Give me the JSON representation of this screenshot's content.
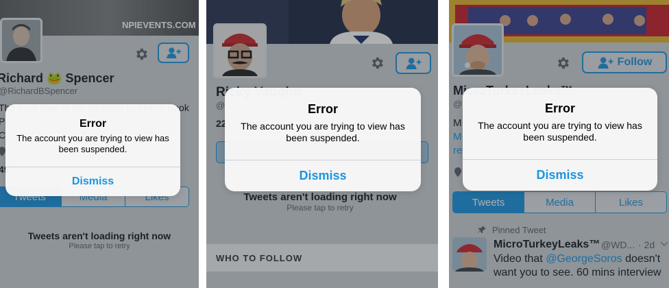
{
  "panels": [
    {
      "banner_text": "NPIEVENTS.COM",
      "name": "Richard",
      "name_suffix": "Spencer",
      "name_emoji": "🐸",
      "handle": "@RichardBSpencer",
      "bio_fragments": [
        "The Kool Man of the Alt-Right to Chess Book",
        "Pr",
        "Co"
      ],
      "stat_fragment": "49",
      "tabs": [
        "Tweets",
        "Media",
        "Likes"
      ],
      "empty_title": "Tweets aren't loading right now",
      "empty_subtitle": "Please tap to retry",
      "alert": {
        "title": "Error",
        "message": "The account you are trying to view has been suspended.",
        "button": "Dismiss"
      }
    },
    {
      "name_fragment": "Ricky Vaughn",
      "handle_fragment": "@",
      "stat_fragment": "22",
      "empty_title": "Tweets aren't loading right now",
      "empty_subtitle": "Please tap to retry",
      "section_header": "WHO TO FOLLOW",
      "alert": {
        "title": "Error",
        "message": "The account you are trying to view has been suspended.",
        "button": "Dismiss"
      }
    },
    {
      "follow_label": "Follow",
      "name_fragment": "MicroTurkeyLeaks™",
      "handle_fragment": "@",
      "bio_fragments": [
        "M",
        "M",
        "re"
      ],
      "tabs": [
        "Tweets",
        "Media",
        "Likes"
      ],
      "pinned_label": "Pinned Tweet",
      "tweet": {
        "author": "MicroTurkeyLeaks™",
        "handle": "@WD...",
        "time": "· 2d",
        "text_before": "Video that ",
        "mention": "@GeorgeSoros",
        "text_after": " doesn't",
        "line2": "want you to see. 60 mins interview"
      },
      "alert": {
        "title": "Error",
        "message": "The account you are trying to view has been suspended.",
        "button": "Dismiss"
      }
    }
  ],
  "colors": {
    "accent": "#1b95e0",
    "page_bg": "#cfd3d7",
    "alert_bg": "#f8f8f8"
  },
  "icons": [
    "gear-icon",
    "add-user-icon",
    "location-pin-icon",
    "pin-icon",
    "chevron-down-icon"
  ]
}
